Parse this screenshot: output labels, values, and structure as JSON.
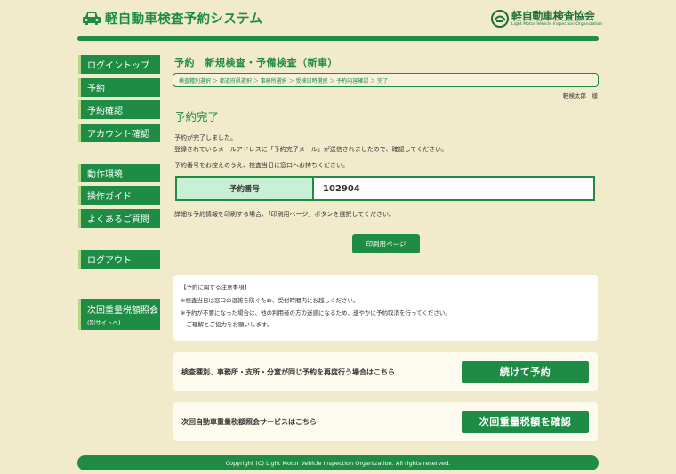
{
  "header": {
    "site_title": "軽自動車検査予約システム",
    "org_name_jp": "軽自動車検査協会",
    "org_name_en": "Light Motor Vehicle Inspection Organization"
  },
  "sidebar": {
    "items": [
      {
        "label": "ログイントップ"
      },
      {
        "label": "予約"
      },
      {
        "label": "予約確認"
      },
      {
        "label": "アカウント確認"
      },
      {
        "label": "動作環境"
      },
      {
        "label": "操作ガイド"
      },
      {
        "label": "よくあるご質問"
      },
      {
        "label": "ログアウト"
      }
    ],
    "tax_link": {
      "label": "次回重量税額照会",
      "sub": "(別サイトへ)"
    }
  },
  "main": {
    "heading": "予約　新規検査・予備検査（新車）",
    "breadcrumb": "検査種別選択 ＞ 都道府県選択 ＞ 事務所選択 ＞ 受検日時選択 ＞ 予約内容確認 ＞ 完了",
    "user_name": "軽検太郎　様",
    "section_title": "予約完了",
    "messages": [
      "予約が完了しました。",
      "登録されているメールアドレスに「予約完了メール」が送信されましたので、確認してください。",
      "予約番号をお控えのうえ、検査当日に窓口へお持ちください。"
    ],
    "reservation": {
      "label": "予約番号",
      "number": "102904"
    },
    "print_message": "詳細な予約情報を印刷する場合、「印刷用ページ」ボタンを選択してください。",
    "print_button": "印刷用ページ",
    "notes": [
      "【予約に関する注意事項】",
      "※検査当日は窓口の混雑を防ぐため、受付時間内にお越しください。",
      "※予約が不要になった場合は、他の利用者の方の迷惑になるため、速やかに予約取消を行ってください。",
      "　ご理解とご協力をお願いします。"
    ],
    "continue": {
      "text": "検査種別、事務所・支所・分室が同じ予約を再度行う場合はこちら",
      "button": "続けて予約"
    },
    "tax": {
      "text": "次回自動車重量税額照会サービスはこちら",
      "button": "次回重量税額を確認"
    }
  },
  "footer": {
    "copyright": "Copyright (C) Light Motor Vehicle Inspection Organization. All rights reserved."
  },
  "colors": {
    "brand_green": "#1e8c45",
    "background": "#f1ebcc",
    "table_label_bg": "#c8f0d5"
  }
}
